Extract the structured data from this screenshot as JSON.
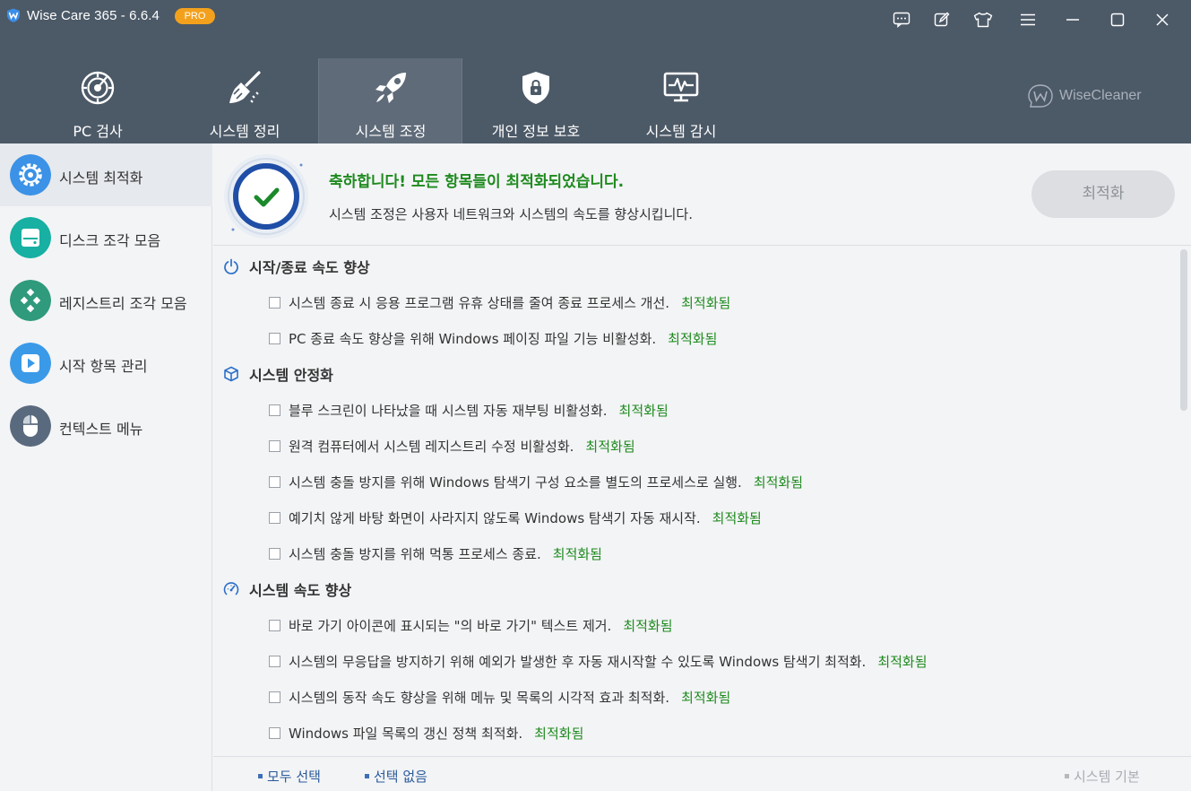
{
  "app": {
    "title": "Wise Care 365 - 6.6.4",
    "badge": "PRO",
    "brand": "WiseCleaner",
    "colors": {
      "header": "#4c5967",
      "accent": "#f3a11d",
      "success": "#1e8a1e"
    }
  },
  "window_controls": [
    {
      "icon": "feedback-icon"
    },
    {
      "icon": "edit-icon"
    },
    {
      "icon": "skin-icon"
    },
    {
      "icon": "menu-icon"
    },
    {
      "icon": "minimize-icon"
    },
    {
      "icon": "maximize-icon"
    },
    {
      "icon": "close-icon"
    }
  ],
  "nav_tabs": [
    {
      "label": "PC 검사",
      "icon": "radar-icon",
      "active": false
    },
    {
      "label": "시스템 정리",
      "icon": "broom-icon",
      "active": false
    },
    {
      "label": "시스템 조정",
      "icon": "rocket-icon",
      "active": true
    },
    {
      "label": "개인 정보 보호",
      "icon": "shield-lock-icon",
      "active": false
    },
    {
      "label": "시스템 감시",
      "icon": "monitor-pulse-icon",
      "active": false
    }
  ],
  "sidebar": {
    "items": [
      {
        "label": "시스템 최적화",
        "icon": "gear-icon",
        "active": true
      },
      {
        "label": "디스크 조각 모음",
        "icon": "disk-icon",
        "active": false
      },
      {
        "label": "레지스트리 조각 모음",
        "icon": "registry-icon",
        "active": false
      },
      {
        "label": "시작 항목 관리",
        "icon": "startup-icon",
        "active": false
      },
      {
        "label": "컨텍스트 메뉴",
        "icon": "mouse-icon",
        "active": false
      }
    ]
  },
  "banner": {
    "title": "축하합니다! 모든 항목들이 최적화되었습니다.",
    "subtitle": "시스템 조정은 사용자 네트워크와 시스템의 속도를 향상시킵니다.",
    "button": "최적화"
  },
  "sections": [
    {
      "title": "시작/종료 속도 향상",
      "icon": "power-icon",
      "items": [
        {
          "text": "시스템 종료 시 응용 프로그램 유휴 상태를 줄여 종료 프로세스 개선.",
          "status": "최적화됨"
        },
        {
          "text": "PC 종료 속도 향상을 위해 Windows 페이징 파일 기능 비활성화.",
          "status": "최적화됨"
        }
      ]
    },
    {
      "title": "시스템 안정화",
      "icon": "cube-icon",
      "items": [
        {
          "text": "블루 스크린이 나타났을 때 시스템 자동 재부팅 비활성화.",
          "status": "최적화됨"
        },
        {
          "text": "원격 컴퓨터에서 시스템 레지스트리 수정 비활성화.",
          "status": "최적화됨"
        },
        {
          "text": "시스템 충돌 방지를 위해 Windows 탐색기 구성 요소를 별도의 프로세스로 실행.",
          "status": "최적화됨"
        },
        {
          "text": "예기치 않게 바탕 화면이 사라지지 않도록 Windows 탐색기 자동 재시작.",
          "status": "최적화됨"
        },
        {
          "text": "시스템 충돌 방지를 위해 먹통 프로세스 종료.",
          "status": "최적화됨"
        }
      ]
    },
    {
      "title": "시스템 속도 향상",
      "icon": "speedometer-icon",
      "items": [
        {
          "text": "바로 가기 아이콘에 표시되는 \"의 바로 가기\" 텍스트 제거.",
          "status": "최적화됨"
        },
        {
          "text": "시스템의 무응답을 방지하기 위해 예외가 발생한 후 자동 재시작할 수 있도록 Windows 탐색기 최적화.",
          "status": "최적화됨"
        },
        {
          "text": "시스템의 동작 속도 향상을 위해 메뉴 및 목록의 시각적 효과 최적화.",
          "status": "최적화됨"
        },
        {
          "text": "Windows 파일 목록의 갱신 정책 최적화.",
          "status": "최적화됨"
        }
      ]
    }
  ],
  "footer": {
    "select_all": "모두 선택",
    "select_none": "선택 없음",
    "system_default": "시스템 기본"
  }
}
